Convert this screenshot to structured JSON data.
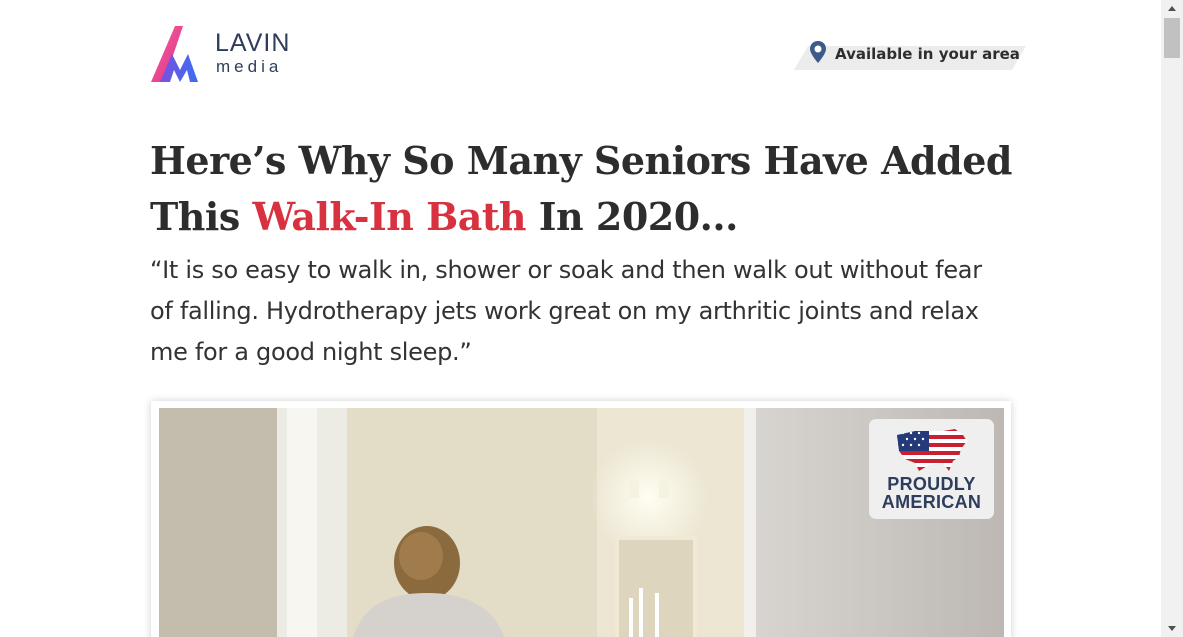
{
  "header": {
    "logo_brand": "LAVIN",
    "logo_sub": "media",
    "area_label": "Available in your area",
    "pin_icon": "location-pin-icon"
  },
  "article": {
    "headline_part1": "Here’s Why So Many Seniors Have Added This ",
    "headline_highlight": "Walk-In Bath",
    "headline_part2": " In 2020...",
    "quote": "“It is so easy to walk in, shower or soak and then walk out without fear of falling. Hydrotherapy jets work great on my arthritic joints and relax me for a good night sleep.”"
  },
  "badge": {
    "line1": "PROUDLY",
    "line2": "AMERICAN"
  },
  "colors": {
    "accent_red": "#d8313f",
    "brand_navy": "#2f3d5c",
    "pin_blue": "#3d5a8a"
  }
}
